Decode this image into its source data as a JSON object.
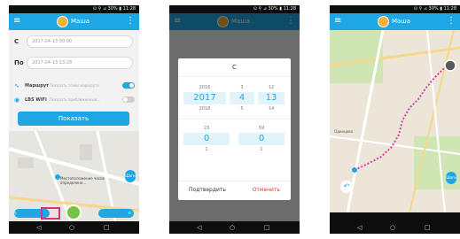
{
  "app": {
    "name": "Маша"
  },
  "status": {
    "text": "⊙ ⚲ ⊿ 30% ▮ 11:28"
  },
  "nav": {
    "back": "◁",
    "home": "○",
    "recent": "□"
  },
  "screen1": {
    "from_label": "С",
    "from_value": "2017-04-13 00:00",
    "to_label": "По",
    "to_value": "2017-04-13 13:28",
    "route_label": "Маршрут",
    "route_hint": "Показать точки маршрута",
    "route_on": true,
    "lbs_label": "LBS WiFi",
    "lbs_hint": "Показать приближенные...",
    "lbs_on": false,
    "show_button": "Показать",
    "map_note": "Местоположение часов определено...",
    "foot_label": "Шаги"
  },
  "screen2": {
    "dialog_title": "С",
    "year": {
      "prev": "2016",
      "sel": "2017",
      "next": "2018"
    },
    "month": {
      "prev": "3",
      "sel": "4",
      "next": "5"
    },
    "day": {
      "prev": "12",
      "sel": "13",
      "next": "14"
    },
    "hour": {
      "prev": "23",
      "sel": "0",
      "next": "1"
    },
    "minute": {
      "prev": "59",
      "sel": "0",
      "next": "1"
    },
    "confirm": "Подтвердить",
    "cancel": "Отменить"
  },
  "screen3": {
    "place_label": "Одинцово",
    "foot_label": "Шаги"
  },
  "colors": {
    "accent": "#1ea7e4",
    "route": "#d63fa8",
    "highlight": "#e0307a",
    "center_button": "#74c343"
  }
}
